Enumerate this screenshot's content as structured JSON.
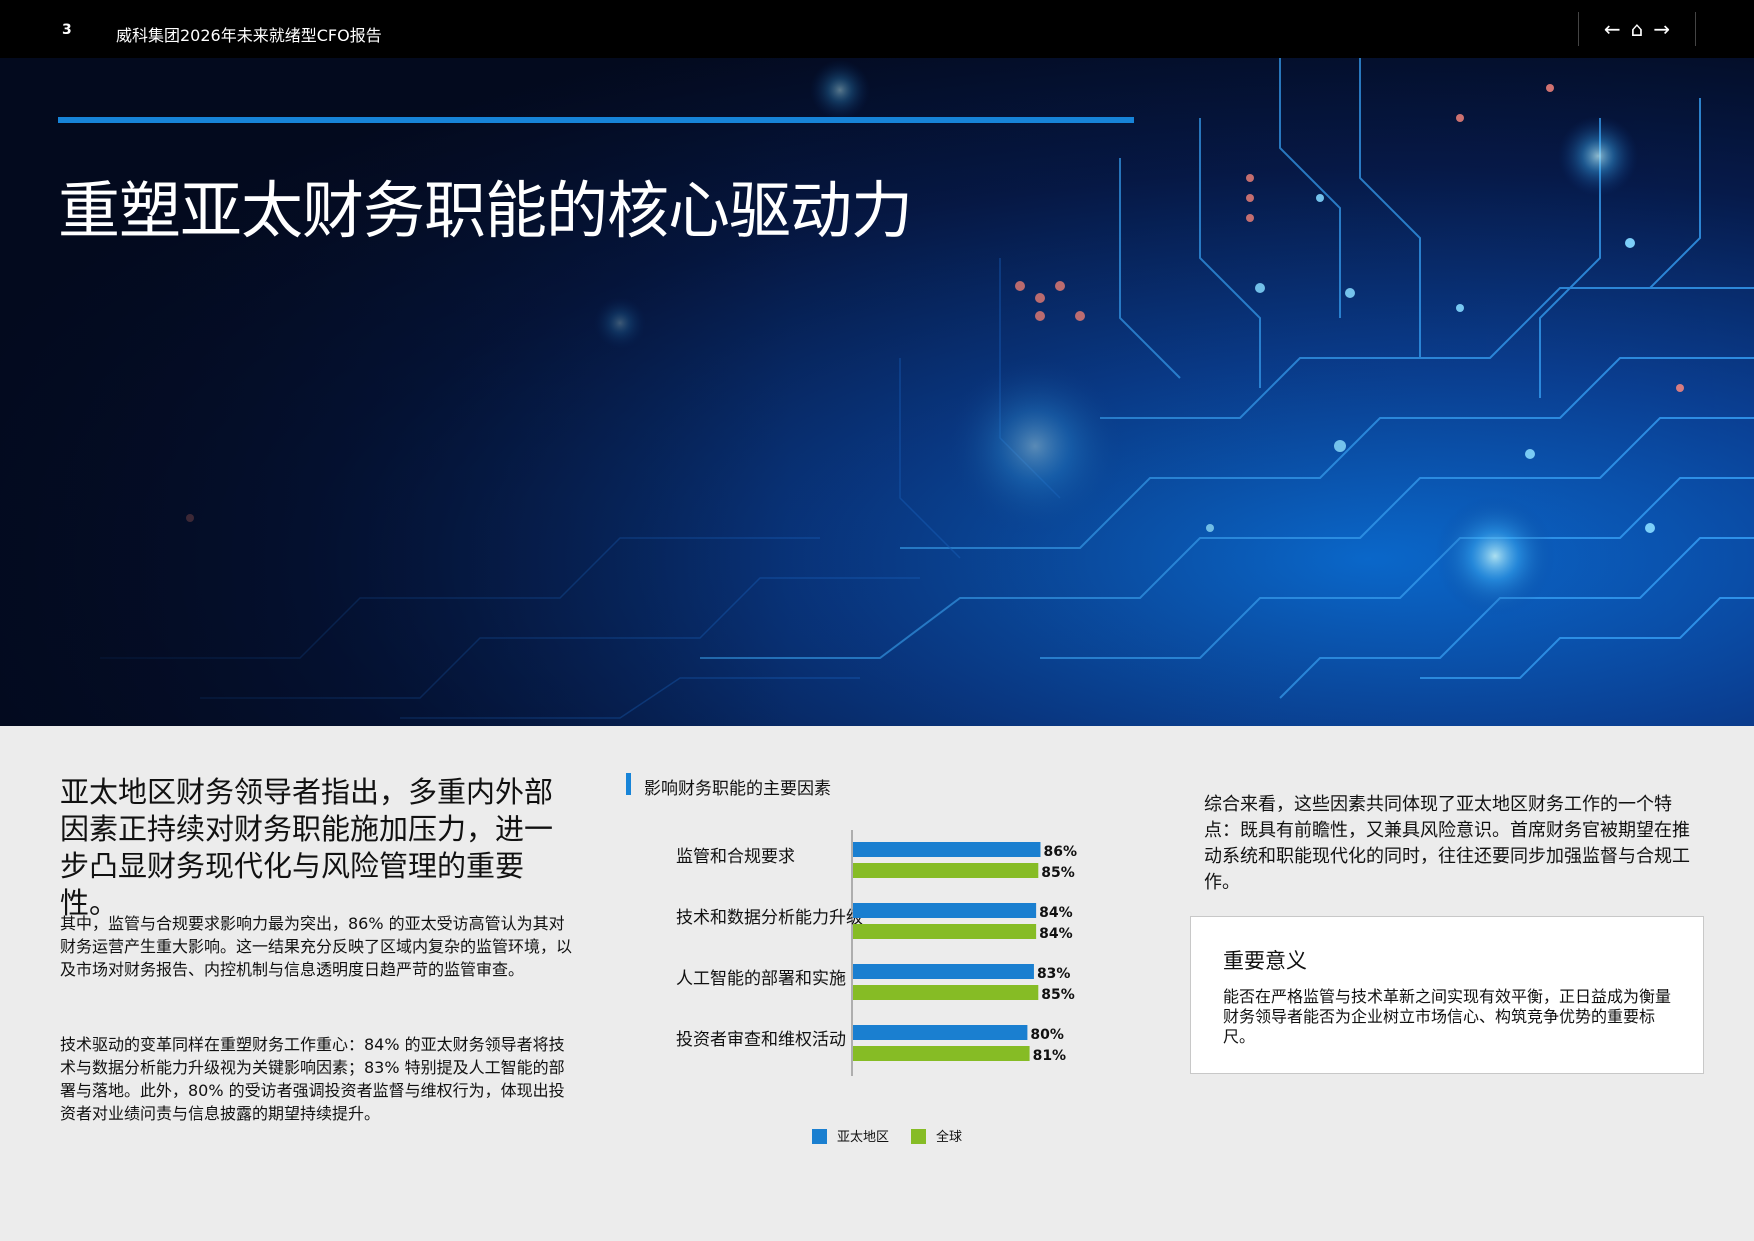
{
  "header": {
    "page_number": "3",
    "doc_title": "威科集团2026年未来就绪型CFO报告",
    "nav": {
      "back": "←",
      "home": "⌂",
      "forward": "→"
    }
  },
  "hero": {
    "title": "重塑亚太财务职能的核心驱动力"
  },
  "left": {
    "lead": "亚太地区财务领导者指出，多重内外部因素正持续对财务职能施加压力，进一步凸显财务现代化与风险管理的重要性。",
    "para1": "其中，监管与合规要求影响力最为突出，86% 的亚太受访高管认为其对财务运营产生重大影响。这一结果充分反映了区域内复杂的监管环境，以及市场对财务报告、内控机制与信息透明度日趋严苛的监管审查。",
    "para2": "技术驱动的变革同样在重塑财务工作重心：84% 的亚太财务领导者将技术与数据分析能力升级视为关键影响因素；83% 特别提及人工智能的部署与落地。此外，80% 的受访者强调投资者监督与维权行为，体现出投资者对业绩问责与信息披露的期望持续提升。"
  },
  "chart_title": "影响财务职能的主要因素",
  "chart_data": {
    "type": "bar",
    "orientation": "horizontal",
    "categories": [
      "监管和合规要求",
      "技术和数据分析能力升级",
      "人工智能的部署和实施",
      "投资者审查和维权活动"
    ],
    "series": [
      {
        "name": "亚太地区",
        "color": "#1a7fd0",
        "values": [
          86,
          84,
          83,
          80
        ],
        "labels": [
          "86%",
          "84%",
          "83%",
          "80%"
        ]
      },
      {
        "name": "全球",
        "color": "#86bc25",
        "values": [
          85,
          84,
          85,
          81
        ],
        "labels": [
          "85%",
          "84%",
          "85%",
          "81%"
        ]
      }
    ],
    "legend_position": "bottom"
  },
  "right": {
    "summary": "综合来看，这些因素共同体现了亚太地区财务工作的一个特点：既具有前瞻性，又兼具风险意识。首席财务官被期望在推动系统和职能现代化的同时，往往还要同步加强监督与合规工作。",
    "box_title": "重要意义",
    "box_text": "能否在严格监管与技术革新之间实现有效平衡，正日益成为衡量财务领导者能否为企业树立市场信心、构筑竞争优势的重要标尺。"
  }
}
